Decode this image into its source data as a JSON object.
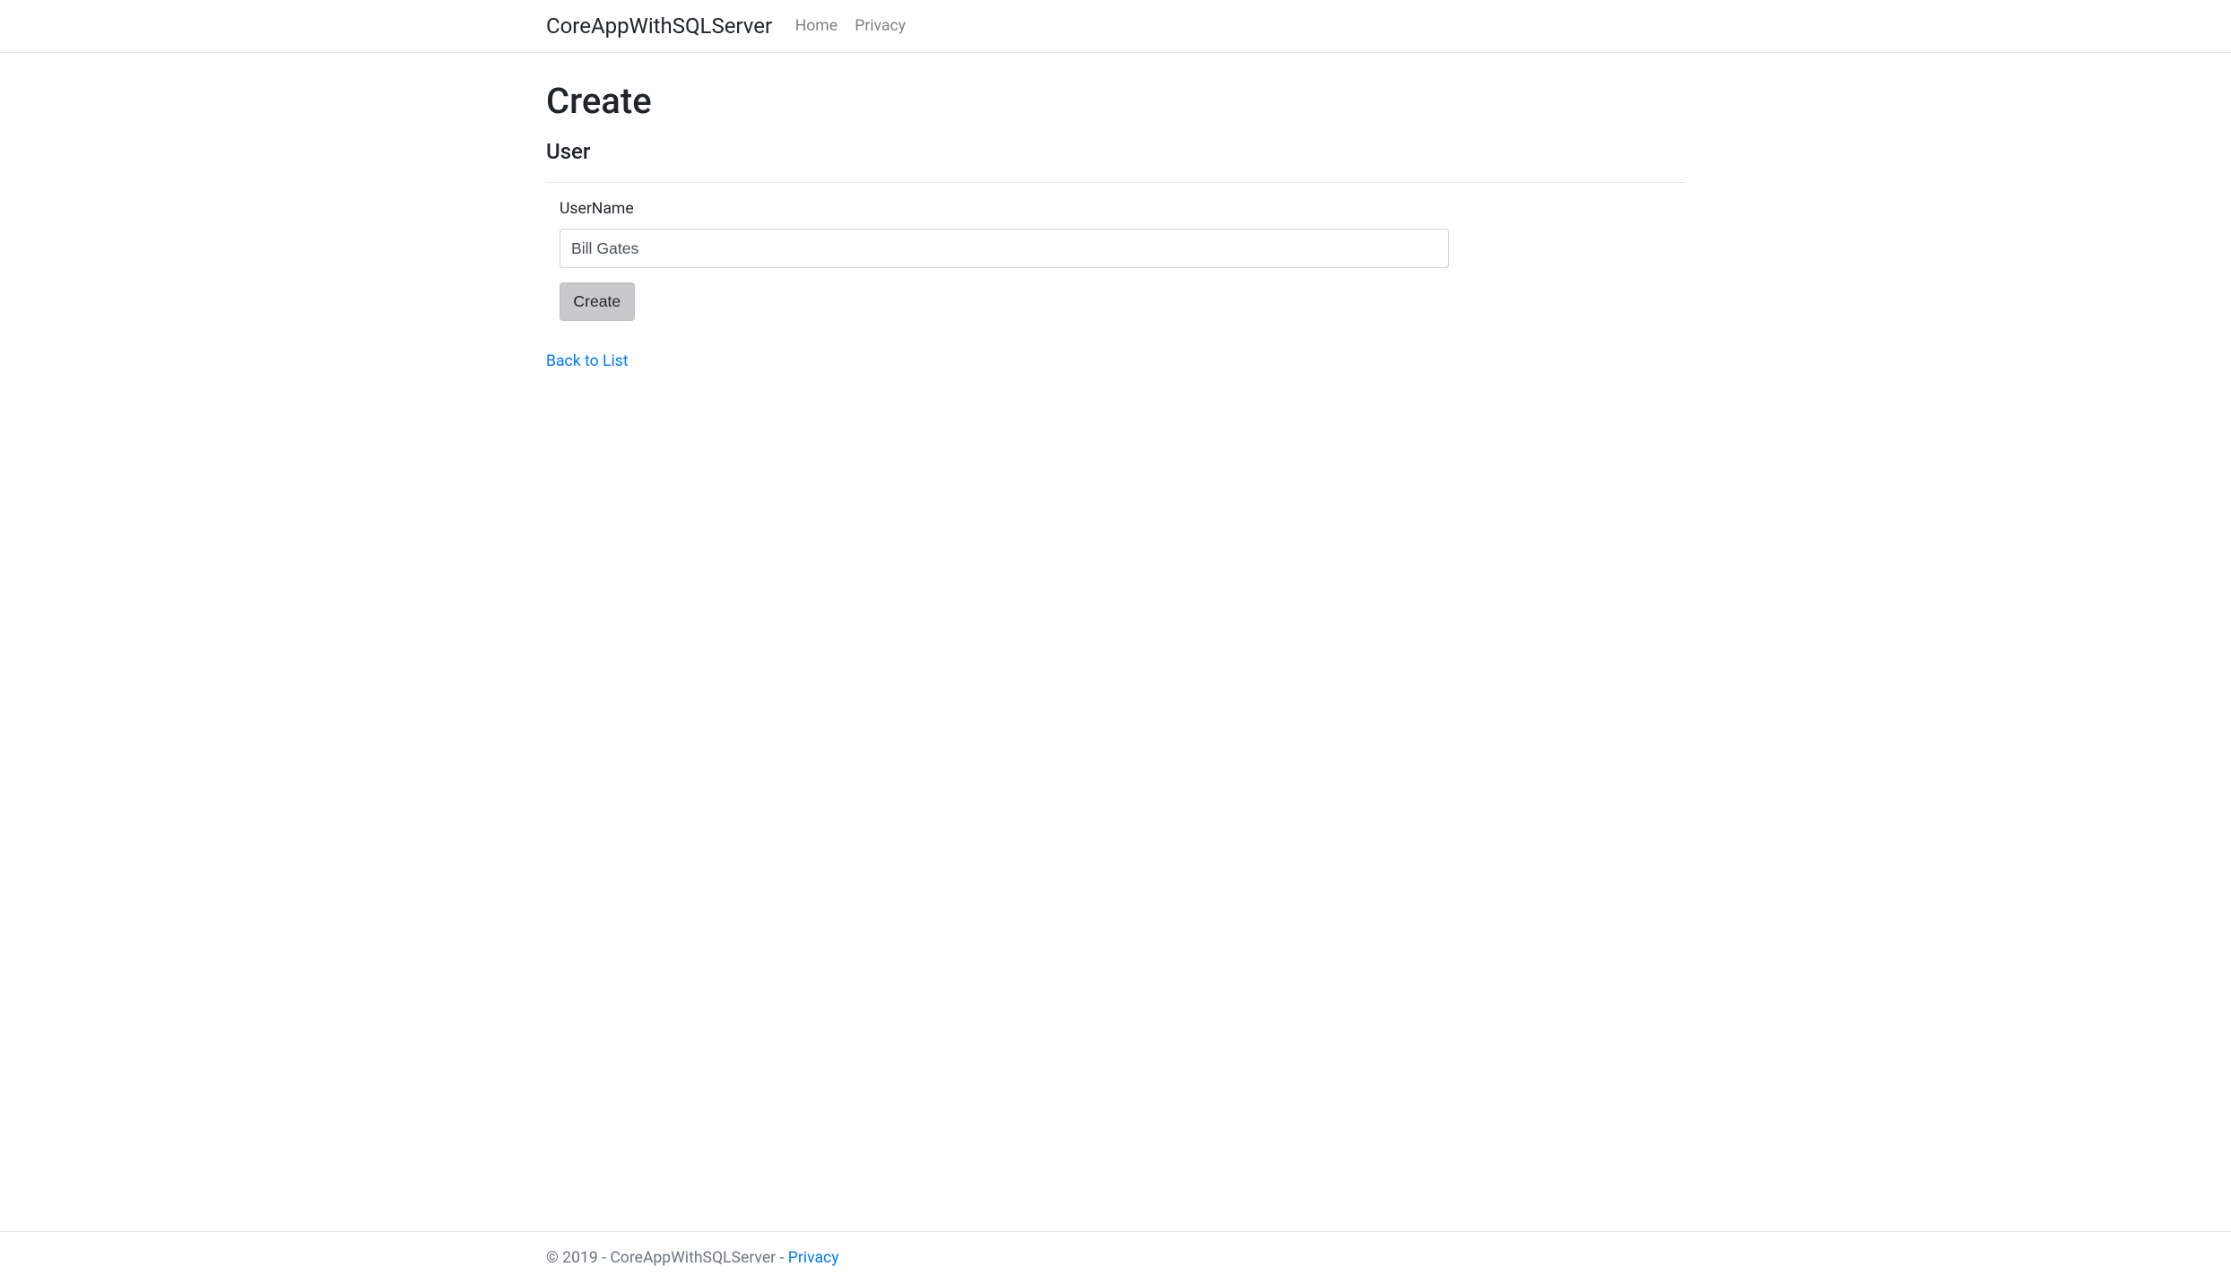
{
  "navbar": {
    "brand": "CoreAppWithSQLServer",
    "links": [
      {
        "label": "Home"
      },
      {
        "label": "Privacy"
      }
    ]
  },
  "page": {
    "title": "Create",
    "subtitle": "User"
  },
  "form": {
    "username_label": "UserName",
    "username_value": "Bill Gates",
    "submit_label": "Create"
  },
  "links": {
    "back_to_list": "Back to List"
  },
  "footer": {
    "copyright": "© 2019 - CoreAppWithSQLServer - ",
    "privacy_label": "Privacy"
  }
}
